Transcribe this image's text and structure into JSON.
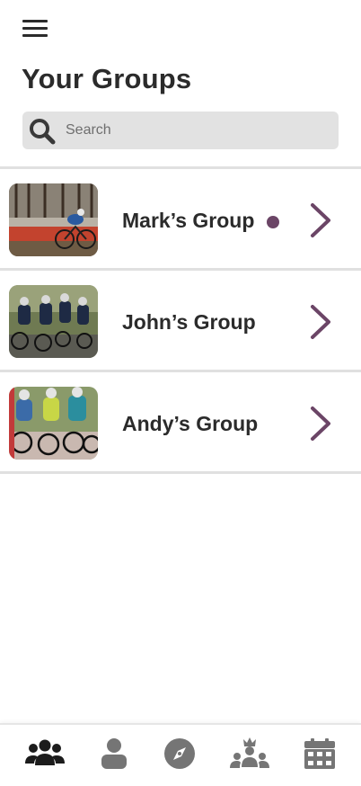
{
  "header": {
    "menu_icon": "hamburger-menu-icon",
    "title": "Your Groups"
  },
  "search": {
    "placeholder": "Search",
    "icon": "magnifier-icon"
  },
  "groups": [
    {
      "name": "Mark’s Group",
      "unread": true,
      "image": "mountain-bike-race-photo"
    },
    {
      "name": "John’s Group",
      "unread": false,
      "image": "road-cyclists-peloton-photo"
    },
    {
      "name": "Andy’s Group",
      "unread": false,
      "image": "road-race-sprint-photo"
    }
  ],
  "bottom_nav": [
    {
      "id": "groups",
      "icon": "people-group-icon",
      "active": true
    },
    {
      "id": "profile",
      "icon": "person-icon",
      "active": false
    },
    {
      "id": "explore",
      "icon": "compass-icon",
      "active": false
    },
    {
      "id": "leaderboard",
      "icon": "crowned-group-icon",
      "active": false
    },
    {
      "id": "calendar",
      "icon": "calendar-icon",
      "active": false
    }
  ],
  "colors": {
    "accent": "#6b4566",
    "text": "#2b2b2b",
    "search_bg": "#e2e2e2",
    "divider": "#e0e0e0",
    "nav_active": "#1c1c1c",
    "nav_inactive": "#757575"
  }
}
